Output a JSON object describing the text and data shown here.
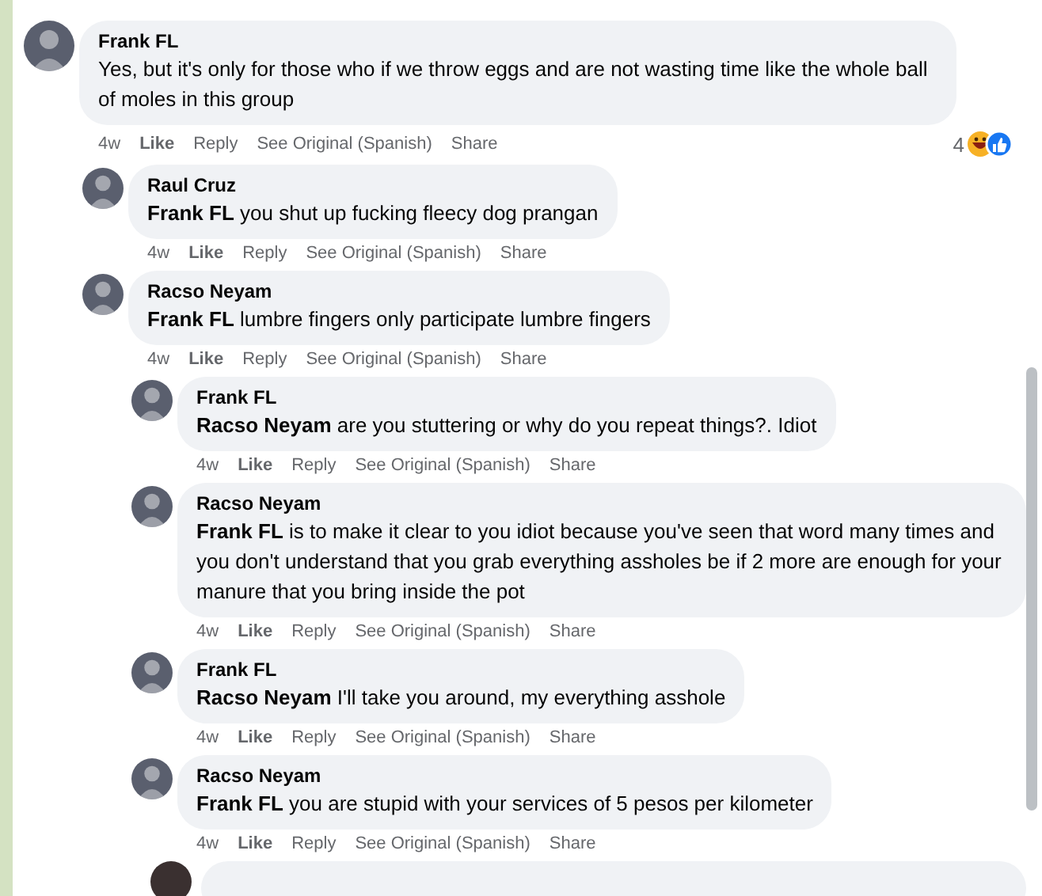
{
  "comments": [
    {
      "author": "Frank FL",
      "text": "Yes, but it's only for those who if we throw eggs and are not wasting time like the whole ball of moles in this group",
      "time": "4w",
      "actions": [
        "Like",
        "Reply",
        "See Original (Spanish)",
        "Share"
      ],
      "reactions": "4",
      "children": [
        {
          "author": "Raul Cruz",
          "text": "**Frank FL** you shut up fucking fleecy dog prangan",
          "time": "4w",
          "actions": [
            "Like",
            "Reply",
            "See Original (Spanish)",
            "Share"
          ]
        },
        {
          "author": "Racso Neyam",
          "text": "**Frank FL** lumbre fingers only participate lumbre fingers",
          "time": "4w",
          "actions": [
            "Like",
            "Reply",
            "See Original (Spanish)",
            "Share"
          ],
          "children": [
            {
              "author": "Frank FL",
              "text": "**Racso Neyam** are you stuttering or why do you repeat things?. Idiot",
              "time": "4w",
              "actions": [
                "Like",
                "Reply",
                "See Original (Spanish)",
                "Share"
              ]
            },
            {
              "author": "Racso Neyam",
              "text": "**Frank FL** is to make it clear to you idiot because you've seen that word many times and you don't understand that you grab everything assholes be if 2 more are enough for your manure that you bring inside the pot",
              "time": "4w",
              "actions": [
                "Like",
                "Reply",
                "See Original (Spanish)",
                "Share"
              ]
            },
            {
              "author": "Frank FL",
              "text": "**Racso Neyam** I'll take you around, my everything asshole",
              "time": "4w",
              "actions": [
                "Like",
                "Reply",
                "See Original (Spanish)",
                "Share"
              ]
            },
            {
              "author": "Racso Neyam",
              "text": "**Frank FL** you are stupid with your services of 5 pesos per kilometer",
              "time": "4w",
              "actions": [
                "Like",
                "Reply",
                "See Original (Spanish)",
                "Share"
              ]
            }
          ]
        }
      ]
    }
  ]
}
